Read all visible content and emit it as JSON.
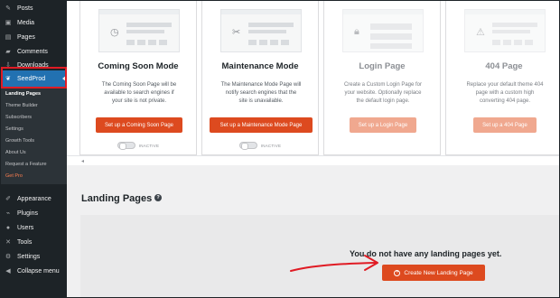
{
  "sidebar": {
    "top_items": [
      {
        "label": "Posts",
        "icon": "pin-icon"
      },
      {
        "label": "Media",
        "icon": "media-icon"
      },
      {
        "label": "Pages",
        "icon": "pages-icon"
      },
      {
        "label": "Comments",
        "icon": "comments-icon"
      },
      {
        "label": "Downloads",
        "icon": "download-icon"
      }
    ],
    "seedprod_label": "SeedProd",
    "submenu": [
      {
        "label": "Landing Pages"
      },
      {
        "label": "Theme Builder"
      },
      {
        "label": "Subscribers"
      },
      {
        "label": "Settings"
      },
      {
        "label": "Growth Tools"
      },
      {
        "label": "About Us"
      },
      {
        "label": "Request a Feature"
      },
      {
        "label": "Get Pro"
      }
    ],
    "bottom_items": [
      {
        "label": "Appearance",
        "icon": "brush-icon"
      },
      {
        "label": "Plugins",
        "icon": "plugin-icon"
      },
      {
        "label": "Users",
        "icon": "users-icon"
      },
      {
        "label": "Tools",
        "icon": "wrench-icon"
      },
      {
        "label": "Settings",
        "icon": "settings-icon"
      },
      {
        "label": "Collapse menu",
        "icon": "collapse-icon"
      }
    ]
  },
  "cards": [
    {
      "title": "Coming Soon Mode",
      "desc": [
        "The Coming Soon Page will be",
        "available to search engines if",
        "your site is not private."
      ],
      "button": "Set up a Coming Soon Page",
      "status": "INACTIVE"
    },
    {
      "title": "Maintenance Mode",
      "desc": [
        "The Maintenance Mode Page will",
        "notify search engines that the",
        "site is unavailable."
      ],
      "button": "Set up a Maintenance Mode Page",
      "status": "INACTIVE"
    },
    {
      "title": "Login Page",
      "desc": [
        "Create a Custom Login Page for",
        "your website. Optionally replace",
        "the default login page."
      ],
      "button": "Set up a Login Page",
      "status": ""
    },
    {
      "title": "404 Page",
      "desc": [
        "Replace your default theme 404",
        "page with a custom high",
        "converting 404 page."
      ],
      "button": "Set up a 404 Page",
      "status": ""
    }
  ],
  "landing": {
    "title": "Landing Pages",
    "empty_message": "You do not have any landing pages yet.",
    "create_button": "Create New Landing Page"
  },
  "colors": {
    "accent": "#dd4a1f",
    "sidebar_bg": "#1d2327",
    "wp_blue": "#2271b1",
    "annotation_red": "#e01b24"
  }
}
